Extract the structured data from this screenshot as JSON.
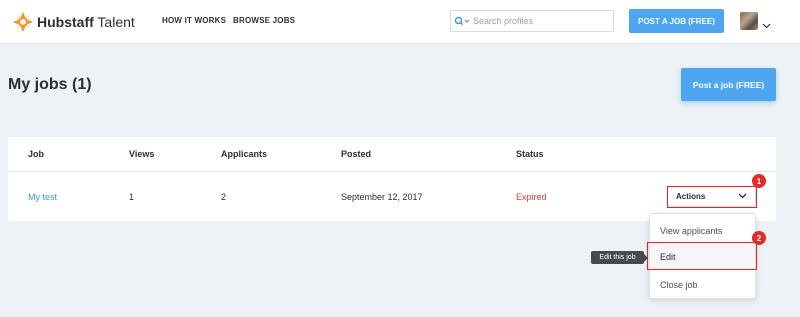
{
  "header": {
    "logo_brand": "Hubstaff",
    "logo_product": "Talent",
    "nav": [
      "HOW IT WORKS",
      "BROWSE JOBS"
    ],
    "search_placeholder": "Search profiles",
    "post_job_label": "POST A JOB (FREE)"
  },
  "page": {
    "title": "My jobs (1)",
    "post_job_label": "Post a job (FREE)"
  },
  "table": {
    "columns": [
      "Job",
      "Views",
      "Applicants",
      "Posted",
      "Status"
    ],
    "rows": [
      {
        "job": "My test",
        "views": "1",
        "applicants": "2",
        "posted": "September 12, 2017",
        "status": "Expired"
      }
    ],
    "actions_label": "Actions"
  },
  "dropdown": {
    "items": [
      "View applicants",
      "Edit",
      "Close job"
    ],
    "tooltip": "Edit this job"
  },
  "annotations": {
    "step1": "1",
    "step2": "2"
  },
  "colors": {
    "accent": "#4ea6f1",
    "link": "#3d97e1",
    "status_expired": "#e3413c",
    "highlight": "#e0262b"
  }
}
